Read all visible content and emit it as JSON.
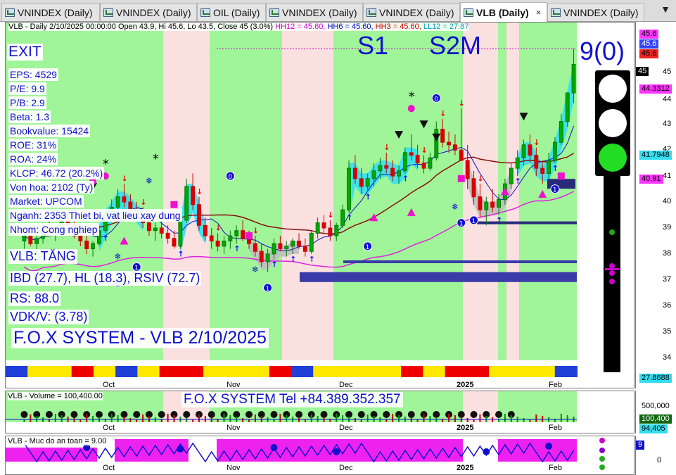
{
  "tabs": [
    {
      "label": "VNINDEX (Daily)",
      "active": false
    },
    {
      "label": "VNINDEX (Daily)",
      "active": false
    },
    {
      "label": "OIL (Daily)",
      "active": false
    },
    {
      "label": "VNINDEX (Daily)",
      "active": false
    },
    {
      "label": "VNINDEX (Daily)",
      "active": false
    },
    {
      "label": "VLB (Daily)",
      "active": true
    },
    {
      "label": "VNINDEX (Daily)",
      "active": false
    }
  ],
  "tab_close_glyph": "×",
  "tab_menu_glyph": "▼",
  "chart_header": {
    "ohlc": "VLB - Daily 2/10/2025 00:00:00 Open 43.9, Hi 45.6, Lo 43.5, Close 45 (3.0%)",
    "hh12": "HH12 = 45.60,",
    "hh6": "HH6 = 45.60,",
    "hh3": "HH3 = 45.60,",
    "ll12": "LL12 = 27.87"
  },
  "labels": {
    "exit": "EXIT",
    "s1": "S1",
    "s2m": "S2M",
    "score": "9(0)",
    "verdict": "VLB: TĂNG",
    "rating": "IBD (27.7), HL (18.3), RSIV (72.7)",
    "rs": "RS: 88.0",
    "vdk": "VDK/V:  (3.78)",
    "system_title": "F.O.X SYSTEM - VLB 2/10/2025"
  },
  "fundamentals": [
    "EPS: 4529",
    "P/E: 9.9",
    "P/B: 2.9",
    "Beta: 1.3",
    "Bookvalue: 15424",
    "ROE: 31%",
    "ROA: 24%",
    "KLCP: 46.72 (20.2%)",
    "Von hoa: 2102 (Ty)",
    "Market: UPCOM",
    "Nganh: 2353 Thiet bi, vat lieu xay dung",
    "Nhom: Cong nghiep"
  ],
  "months": [
    {
      "label": "Oct",
      "year": false
    },
    {
      "label": "Nov",
      "year": false
    },
    {
      "label": "Dec",
      "year": false
    },
    {
      "label": "2025",
      "year": true
    },
    {
      "label": "Feb",
      "year": false
    }
  ],
  "traffic_light": {
    "lamps": [
      "#ffffff",
      "#ffffff",
      "#22dd22"
    ],
    "pole_dots": [
      "#22aa22",
      "#cc00cc",
      "#cc00cc",
      "#cc00cc"
    ]
  },
  "price_axis": {
    "ticks": [
      "45",
      "44",
      "43",
      "42",
      "41",
      "40",
      "39",
      "38",
      "37",
      "36",
      "35",
      "34"
    ],
    "tags": [
      {
        "text": "45.6",
        "bg": "#ff33ff",
        "fg": "#000000"
      },
      {
        "text": "45.6",
        "bg": "#3344ff",
        "fg": "#ffffff"
      },
      {
        "text": "45.6",
        "bg": "#ee2222",
        "fg": "#000000"
      },
      {
        "text": "45",
        "bg": "#000000",
        "fg": "#ffffff"
      },
      {
        "text": "44.3312",
        "bg": "#ff33ff",
        "fg": "#000000"
      },
      {
        "text": "41.7948",
        "bg": "#33ddee",
        "fg": "#000000"
      },
      {
        "text": "40.91",
        "bg": "#ff33ff",
        "fg": "#000000"
      },
      {
        "text": "27.8688",
        "bg": "#33ddee",
        "fg": "#000000"
      }
    ]
  },
  "volume": {
    "header": "VLB - Volume = 100,400.00",
    "phone": "F.O.X SYSTEM Tel +84.389.352.357",
    "axis_label": "500,000",
    "tags": [
      {
        "text": "100,400",
        "bg": "#116611",
        "fg": "#ffffff"
      },
      {
        "text": "94,405",
        "bg": "#33ddee",
        "fg": "#000000"
      }
    ]
  },
  "safety": {
    "header": "VLB - Muc do an toan = 9.00",
    "axis_label": "0",
    "tag": {
      "text": "9",
      "bg": "#1010cc",
      "fg": "#ffffff"
    },
    "dots": [
      "#cc00cc",
      "#8800cc",
      "#22aa22",
      "#22aa22"
    ]
  },
  "bar_markers": {
    "sequence": [
      "1",
      "1",
      "1",
      "1",
      "0",
      "0",
      "1",
      "1",
      "1",
      "1"
    ]
  },
  "chart_data": {
    "type": "candlestick",
    "symbol": "VLB",
    "interval": "Daily",
    "last_bar": {
      "date": "2/10/2025",
      "open": 43.9,
      "high": 45.6,
      "low": 43.5,
      "close": 45,
      "change_pct": 3.0
    },
    "ylim": [
      33.5,
      46.5
    ],
    "x_ticks": [
      "Oct",
      "Nov",
      "Dec",
      "2025",
      "Feb"
    ],
    "y_ticks": [
      34,
      35,
      36,
      37,
      38,
      39,
      40,
      41,
      42,
      43,
      44,
      45
    ],
    "levels": {
      "hh12": 45.6,
      "hh6": 45.6,
      "hh3": 45.6,
      "ll12": 27.87,
      "ma_fast": 44.3312,
      "band": 41.7948,
      "ma_slow": 40.91,
      "low_band": 27.8688
    },
    "candles": [
      [
        38.2,
        38.6,
        37.9,
        38.4
      ],
      [
        38.4,
        38.7,
        38.0,
        38.1
      ],
      [
        38.1,
        38.5,
        37.8,
        38.3
      ],
      [
        38.3,
        38.9,
        38.1,
        38.7
      ],
      [
        38.7,
        39.0,
        38.4,
        38.5
      ],
      [
        38.5,
        38.8,
        38.2,
        38.6
      ],
      [
        38.6,
        39.2,
        38.5,
        39.0
      ],
      [
        39.0,
        39.3,
        38.7,
        38.8
      ],
      [
        38.8,
        39.0,
        38.3,
        38.4
      ],
      [
        38.4,
        38.6,
        38.0,
        38.2
      ],
      [
        38.2,
        38.5,
        37.7,
        37.9
      ],
      [
        37.9,
        38.2,
        37.6,
        38.1
      ],
      [
        38.1,
        38.8,
        38.0,
        38.6
      ],
      [
        38.6,
        39.4,
        38.5,
        39.2
      ],
      [
        39.2,
        39.8,
        39.0,
        39.5
      ],
      [
        39.5,
        40.2,
        39.3,
        39.9
      ],
      [
        39.9,
        40.4,
        39.5,
        39.7
      ],
      [
        39.7,
        40.0,
        39.2,
        39.4
      ],
      [
        39.4,
        39.7,
        39.0,
        39.2
      ],
      [
        39.2,
        39.5,
        38.7,
        38.9
      ],
      [
        38.9,
        39.1,
        38.4,
        38.6
      ],
      [
        38.6,
        38.9,
        38.2,
        38.7
      ],
      [
        38.7,
        39.0,
        38.3,
        38.5
      ],
      [
        38.5,
        38.8,
        38.1,
        38.3
      ],
      [
        38.3,
        38.6,
        37.9,
        38.0
      ],
      [
        38.0,
        39.2,
        37.9,
        39.0
      ],
      [
        39.0,
        40.6,
        38.9,
        40.3
      ],
      [
        40.3,
        40.8,
        39.4,
        39.6
      ],
      [
        39.6,
        39.9,
        38.6,
        38.8
      ],
      [
        38.8,
        39.1,
        38.2,
        38.4
      ],
      [
        38.4,
        38.7,
        37.9,
        38.2
      ],
      [
        38.2,
        38.5,
        37.8,
        38.0
      ],
      [
        38.0,
        38.4,
        37.7,
        38.2
      ],
      [
        38.2,
        38.6,
        37.9,
        38.4
      ],
      [
        38.4,
        38.8,
        38.1,
        38.6
      ],
      [
        38.6,
        39.0,
        38.2,
        38.3
      ],
      [
        38.3,
        38.6,
        37.9,
        38.1
      ],
      [
        38.1,
        38.4,
        37.6,
        37.8
      ],
      [
        37.8,
        38.1,
        37.2,
        37.4
      ],
      [
        37.4,
        37.9,
        37.0,
        37.7
      ],
      [
        37.7,
        38.3,
        37.5,
        38.1
      ],
      [
        38.1,
        38.4,
        37.8,
        37.9
      ],
      [
        37.9,
        38.2,
        37.6,
        38.0
      ],
      [
        38.0,
        38.3,
        37.7,
        38.2
      ],
      [
        38.2,
        38.5,
        37.9,
        38.0
      ],
      [
        38.0,
        38.3,
        37.6,
        37.8
      ],
      [
        37.8,
        38.6,
        37.7,
        38.5
      ],
      [
        38.5,
        39.1,
        38.3,
        38.9
      ],
      [
        38.9,
        39.2,
        38.5,
        38.7
      ],
      [
        38.7,
        39.0,
        38.2,
        38.4
      ],
      [
        38.4,
        38.9,
        38.2,
        38.8
      ],
      [
        38.8,
        39.6,
        38.7,
        39.4
      ],
      [
        39.4,
        41.3,
        39.3,
        41.0
      ],
      [
        41.0,
        41.5,
        40.4,
        40.6
      ],
      [
        40.6,
        41.0,
        40.0,
        40.3
      ],
      [
        40.3,
        40.8,
        40.1,
        40.6
      ],
      [
        40.6,
        41.2,
        40.3,
        40.9
      ],
      [
        40.9,
        41.4,
        40.6,
        41.1
      ],
      [
        41.1,
        41.6,
        40.8,
        41.0
      ],
      [
        41.0,
        41.3,
        40.5,
        40.7
      ],
      [
        40.7,
        41.1,
        40.4,
        40.9
      ],
      [
        40.9,
        41.8,
        40.8,
        41.6
      ],
      [
        41.6,
        42.3,
        41.3,
        41.5
      ],
      [
        41.5,
        41.9,
        41.0,
        41.2
      ],
      [
        41.2,
        41.5,
        40.8,
        41.0
      ],
      [
        41.0,
        41.6,
        40.9,
        41.4
      ],
      [
        41.4,
        42.8,
        41.3,
        42.5
      ],
      [
        42.5,
        42.9,
        41.8,
        42.0
      ],
      [
        42.0,
        42.4,
        41.6,
        41.9
      ],
      [
        41.9,
        42.3,
        41.5,
        41.7
      ],
      [
        41.7,
        43.3,
        41.6,
        41.3
      ],
      [
        41.3,
        41.9,
        40.2,
        40.6
      ],
      [
        40.6,
        40.9,
        39.6,
        39.9
      ],
      [
        39.9,
        40.4,
        39.1,
        39.4
      ],
      [
        39.4,
        39.9,
        38.8,
        39.7
      ],
      [
        39.7,
        40.2,
        39.3,
        39.5
      ],
      [
        39.5,
        40.0,
        39.2,
        39.8
      ],
      [
        39.8,
        40.6,
        39.6,
        40.4
      ],
      [
        40.4,
        41.2,
        40.2,
        41.0
      ],
      [
        41.0,
        41.7,
        40.7,
        41.4
      ],
      [
        41.4,
        42.1,
        41.1,
        41.9
      ],
      [
        41.9,
        42.3,
        41.2,
        41.5
      ],
      [
        41.5,
        41.8,
        40.7,
        41.0
      ],
      [
        41.0,
        41.3,
        40.4,
        40.8
      ],
      [
        40.8,
        41.6,
        40.6,
        41.3
      ],
      [
        41.3,
        42.2,
        41.2,
        42.0
      ],
      [
        42.0,
        43.1,
        41.9,
        42.8
      ],
      [
        42.8,
        43.9,
        42.6,
        43.9
      ],
      [
        43.9,
        45.6,
        43.5,
        45.0
      ]
    ]
  }
}
